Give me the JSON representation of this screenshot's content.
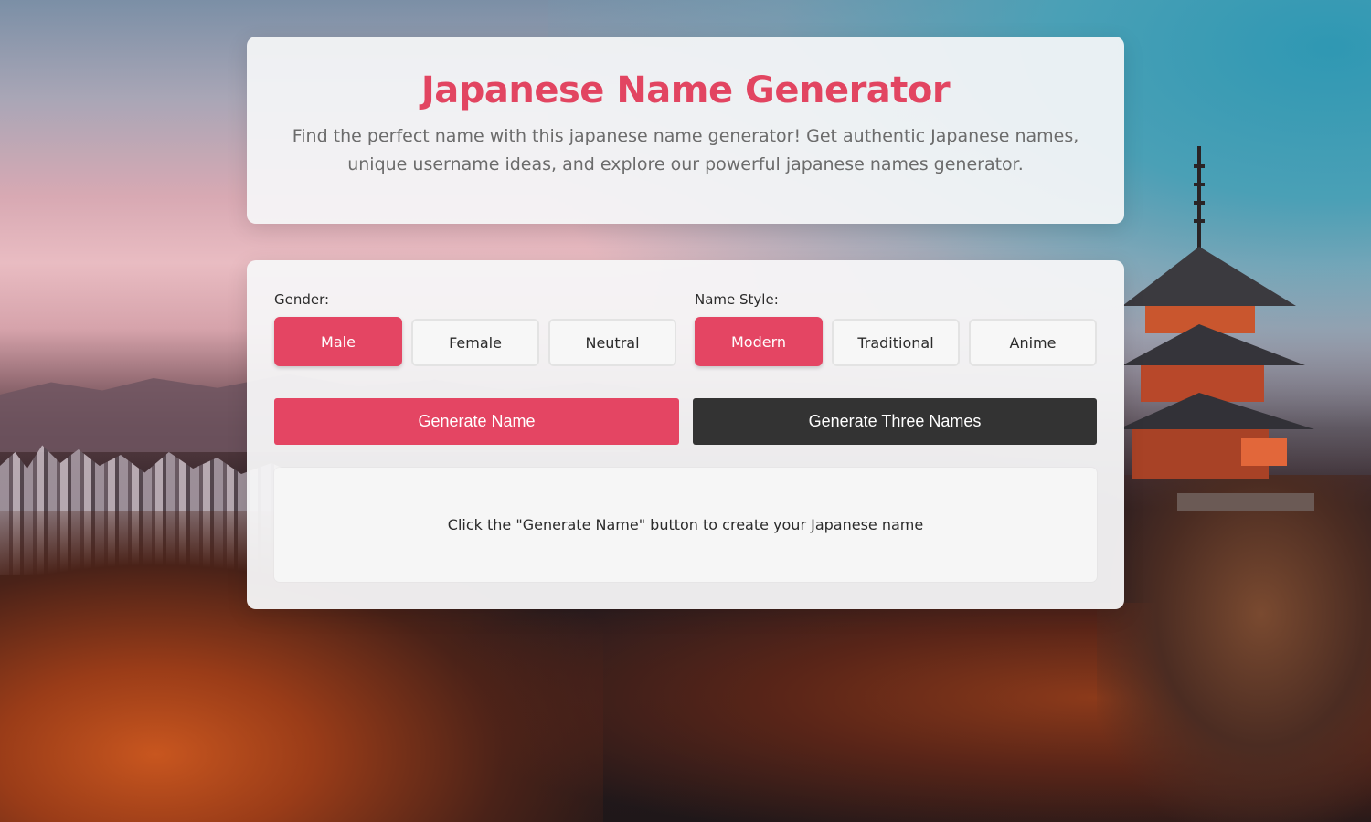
{
  "header": {
    "title": "Japanese Name Generator",
    "subtitle": "Find the perfect name with this japanese name generator! Get authentic Japanese names, unique username ideas, and explore our powerful japanese names generator."
  },
  "form": {
    "gender": {
      "label": "Gender:",
      "options": [
        "Male",
        "Female",
        "Neutral"
      ],
      "selected": "Male"
    },
    "style": {
      "label": "Name Style:",
      "options": [
        "Modern",
        "Traditional",
        "Anime"
      ],
      "selected": "Modern"
    },
    "generate_label": "Generate Name",
    "generate_three_label": "Generate Three Names",
    "result_placeholder": "Click the \"Generate Name\" button to create your Japanese name"
  },
  "colors": {
    "accent": "#e44563",
    "title": "#e24561",
    "dark_button": "#333333",
    "card": "#f6f6f7"
  }
}
